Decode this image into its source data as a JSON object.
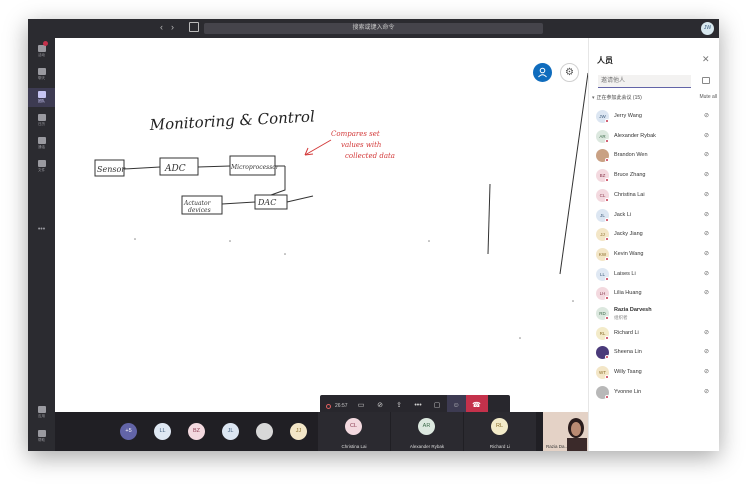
{
  "titlebar": {
    "search_placeholder": "搜索或键入命令",
    "me_initials": "JW"
  },
  "rail": [
    {
      "label": "活动",
      "icon": "bell-icon"
    },
    {
      "label": "聊天",
      "icon": "chat-icon"
    },
    {
      "label": "团队",
      "icon": "teams-icon",
      "active": true
    },
    {
      "label": "日历",
      "icon": "calendar-icon"
    },
    {
      "label": "通话",
      "icon": "phone-icon"
    },
    {
      "label": "文件",
      "icon": "file-icon"
    }
  ],
  "rail_more": "•••",
  "rail_bottom": [
    {
      "label": "应用",
      "icon": "apps-icon"
    },
    {
      "label": "帮助",
      "icon": "help-icon"
    }
  ],
  "whiteboard": {
    "title": "Monitoring & Control",
    "boxes": [
      "Sensor",
      "ADC",
      "Microprocessor",
      "DAC",
      "Actuator devices"
    ],
    "annotation": [
      "Compares set",
      "values with",
      "collected data"
    ]
  },
  "ink_colors": {
    "accent": "#0f6cbd",
    "annotation": "#d33a3a",
    "pens": [
      "#222222",
      "#d33a3a",
      "#1b8a4c",
      "#1a7fd0",
      "#e89bb0"
    ]
  },
  "callbar": {
    "timer": "26:57"
  },
  "video_strip": {
    "overflow": "+5",
    "chips": [
      {
        "initials": "LL",
        "bg": "#dfe8f3",
        "fg": "#3c5a7a"
      },
      {
        "initials": "BZ",
        "bg": "#f3d9df",
        "fg": "#8a3b50"
      },
      {
        "initials": "JL",
        "bg": "#dce6f2",
        "fg": "#3c5a7a"
      },
      {
        "initials": "",
        "bg": "#d8d8d8",
        "fg": "#555555"
      },
      {
        "initials": "JJ",
        "bg": "#f3e6c7",
        "fg": "#8a6d2a"
      }
    ],
    "tiles": [
      {
        "initials": "CL",
        "name": "Christina Lai",
        "bg": "#f3d9df",
        "fg": "#8a3b50"
      },
      {
        "initials": "AR",
        "name": "Alexander Rybak",
        "bg": "#dce8df",
        "fg": "#3c6a4a"
      },
      {
        "initials": "RL",
        "name": "Richard Li",
        "bg": "#f3ebc9",
        "fg": "#8a6d2a"
      }
    ],
    "video_name": "Razia Da..."
  },
  "people_panel": {
    "title": "人员",
    "invite_placeholder": "邀请他人",
    "section_label": "正在参加此会议 (15)",
    "mute_all": "Mute all",
    "people": [
      {
        "initials": "JW",
        "name": "Jerry Wang",
        "bg": "#dce6f2",
        "fg": "#3c5a7a",
        "status": "#c4314b"
      },
      {
        "initials": "AR",
        "name": "Alexander Rybak",
        "bg": "#dce8df",
        "fg": "#3c6a4a",
        "status": "#c4314b"
      },
      {
        "initials": "",
        "name": "Brandon Wen",
        "bg": "#c9a184",
        "fg": "#ffffff",
        "status": "#c4314b"
      },
      {
        "initials": "BZ",
        "name": "Bruce Zhang",
        "bg": "#f3d9df",
        "fg": "#8a3b50",
        "status": "#c4314b"
      },
      {
        "initials": "CL",
        "name": "Christina Lai",
        "bg": "#f3d9df",
        "fg": "#8a3b50",
        "status": "#c4314b"
      },
      {
        "initials": "JL",
        "name": "Jack Li",
        "bg": "#dce6f2",
        "fg": "#3c5a7a",
        "status": "#c4314b"
      },
      {
        "initials": "JJ",
        "name": "Jacky Jiang",
        "bg": "#f3e6c7",
        "fg": "#8a6d2a",
        "status": "#c4314b"
      },
      {
        "initials": "KW",
        "name": "Kevin Wang",
        "bg": "#f3e6c7",
        "fg": "#8a6d2a",
        "status": "#c4314b"
      },
      {
        "initials": "LL",
        "name": "Laises Li",
        "bg": "#dfe8f3",
        "fg": "#3c5a7a",
        "status": "#c4314b"
      },
      {
        "initials": "LH",
        "name": "Lilia Huang",
        "bg": "#f3d9df",
        "fg": "#8a3b50",
        "status": "#c4314b"
      },
      {
        "initials": "RD",
        "name": "Razia Darvesh",
        "subtitle": "组织者",
        "bg": "#dce8df",
        "fg": "#3c6a4a",
        "status": "#c4314b",
        "bold": true
      },
      {
        "initials": "RL",
        "name": "Richard Li",
        "bg": "#f3ebc9",
        "fg": "#8a6d2a",
        "status": "#c4314b"
      },
      {
        "initials": "",
        "name": "Sheena Lin",
        "bg": "#4a3a7a",
        "fg": "#ffffff",
        "status": "#c4314b"
      },
      {
        "initials": "WT",
        "name": "Willy Tsang",
        "bg": "#f3e6c7",
        "fg": "#8a6d2a",
        "status": "#c4314b"
      },
      {
        "initials": "",
        "name": "Yvonne Lin",
        "bg": "#b8b8b8",
        "fg": "#ffffff",
        "status": "#c4314b"
      }
    ]
  }
}
